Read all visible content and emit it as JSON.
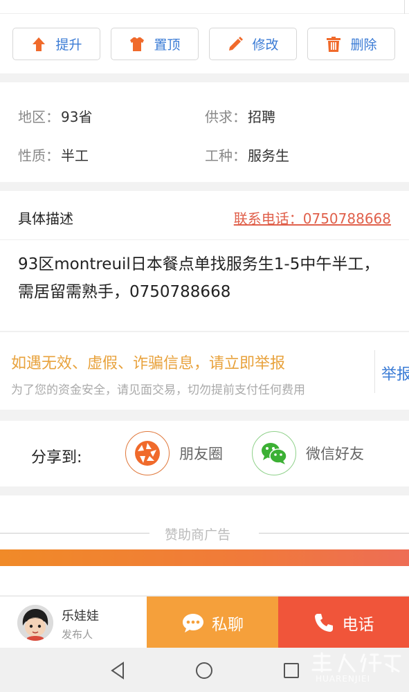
{
  "actions": [
    {
      "label": "提升",
      "icon": "arrow-up-icon"
    },
    {
      "label": "置顶",
      "icon": "tshirt-icon"
    },
    {
      "label": "修改",
      "icon": "pencil-icon"
    },
    {
      "label": "删除",
      "icon": "trash-icon"
    }
  ],
  "info": {
    "region_label": "地区：",
    "region_value": "93省",
    "supply_label": "供求：",
    "supply_value": "招聘",
    "nature_label": "性质：",
    "nature_value": "半工",
    "job_label": "工种：",
    "job_value": "服务生"
  },
  "description": {
    "title": "具体描述",
    "contact": "联系电话：0750788668",
    "body": "93区montreuil日本餐点单找服务生1-5中午半工，需居留需熟手，0750788668"
  },
  "warning": {
    "main": "如遇无效、虚假、诈骗信息，请立即举报",
    "sub": "为了您的资金安全，请见面交易，切勿提前支付任何费用",
    "report": "举报"
  },
  "share": {
    "label": "分享到:",
    "moments": "朋友圈",
    "wechat": "微信好友"
  },
  "ads": {
    "label": "赞助商广告"
  },
  "publisher": {
    "name": "乐娃娃",
    "role": "发布人"
  },
  "bottom": {
    "chat": "私聊",
    "call": "电话"
  },
  "watermark": {
    "text": "HUARENJIEI"
  },
  "colors": {
    "accent_blue": "#3a7bd5",
    "icon_orange": "#f06a2b",
    "chat_orange": "#f5a03b",
    "call_red": "#f0553a",
    "warn_orange": "#e8a23c",
    "wechat_green": "#3cb034"
  }
}
